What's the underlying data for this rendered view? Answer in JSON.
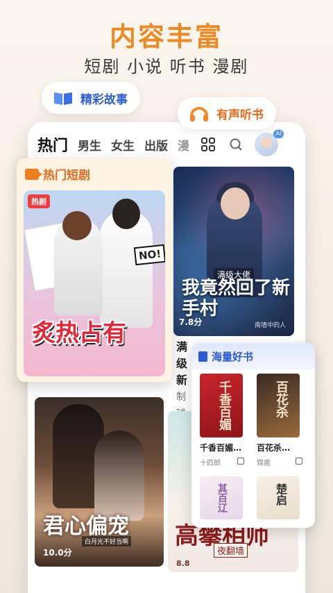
{
  "header": {
    "headline": "内容丰富",
    "subline": "短剧 小说 听书 漫剧"
  },
  "bubbles": {
    "story_label": "精彩故事",
    "audio_label": "有声听书"
  },
  "tabs": [
    {
      "label": "热门"
    },
    {
      "label": "男生"
    },
    {
      "label": "女生"
    },
    {
      "label": "出版"
    },
    {
      "label": "漫"
    }
  ],
  "ai_badge": "AI",
  "main_card": {
    "small_text": "满级大佬",
    "title": "我竟然回了新手村",
    "score": "7.8分",
    "author": "南墙中的人",
    "below_line1": "满级",
    "below_line2": "新",
    "below_line3": "制",
    "below_line4": "球"
  },
  "hot_drama": {
    "header": "热门短剧",
    "tag": "热剧",
    "no_text": "NO!",
    "title": "炙热占有"
  },
  "lower_left": {
    "title": "君心偏宠",
    "small": "白月光不好当啊",
    "score": "10.0分"
  },
  "lower_right": {
    "title": "高攀相师",
    "sub": "夜翻墙",
    "score": "8.8"
  },
  "books": {
    "header": "海量好书",
    "items": [
      {
        "name": "千香百媚…",
        "author": "十四郎",
        "cover_text": "千香百媚"
      },
      {
        "name": "百花杀…",
        "author": "锦凰",
        "cover_text": "百花杀"
      },
      {
        "name": "",
        "author": "",
        "cover_text": "其百辽"
      },
      {
        "name": "",
        "author": "",
        "cover_text": "楚启"
      }
    ]
  },
  "colors": {
    "accent": "#ee8a23",
    "story_blue": "#2f5fd0",
    "drama_orange": "#e26b1d",
    "books_blue": "#2e5bd4"
  }
}
